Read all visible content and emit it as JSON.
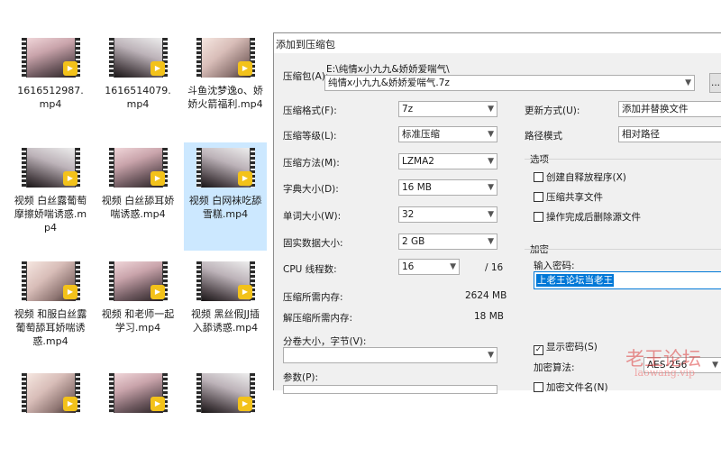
{
  "explorer": {
    "files": [
      {
        "name": "1616512987.mp4",
        "selected": false,
        "variant": ""
      },
      {
        "name": "1616514079.mp4",
        "selected": false,
        "variant": "alt1"
      },
      {
        "name": "斗鱼沈梦逸o、娇娇火箭福利.mp4",
        "selected": false,
        "variant": "alt2"
      },
      {
        "name": "视频 白丝露葡萄摩擦娇喘诱惑.mp4",
        "selected": false,
        "variant": "alt1"
      },
      {
        "name": "视频 白丝舔耳娇喘诱惑.mp4",
        "selected": false,
        "variant": ""
      },
      {
        "name": "视频 白网袜吃舔雪糕.mp4",
        "selected": true,
        "variant": "alt1"
      },
      {
        "name": "视频 和服白丝露葡萄舔耳娇喘诱惑.mp4",
        "selected": false,
        "variant": "alt2"
      },
      {
        "name": "视频 和老师一起学习.mp4",
        "selected": false,
        "variant": ""
      },
      {
        "name": "视频 黑丝假JJ插入舔诱惑.mp4",
        "selected": false,
        "variant": "alt1"
      },
      {
        "name": "",
        "selected": false,
        "variant": "alt2"
      },
      {
        "name": "",
        "selected": false,
        "variant": ""
      },
      {
        "name": "",
        "selected": false,
        "variant": "alt1"
      }
    ],
    "badge_text": "Player"
  },
  "dialog": {
    "title": "添加到压缩包",
    "archive_label": "压缩包(A):",
    "archive_path": "E:\\纯情x小九九&娇娇爱喘气\\",
    "archive_name": "纯情x小九九&娇娇爱喘气.7z",
    "browse_label": "...",
    "format_label": "压缩格式(F):",
    "format_value": "7z",
    "level_label": "压缩等级(L):",
    "level_value": "标准压缩",
    "method_label": "压缩方法(M):",
    "method_value": "LZMA2",
    "dict_label": "字典大小(D):",
    "dict_value": "16 MB",
    "word_label": "单词大小(W):",
    "word_value": "32",
    "solid_label": "固实数据大小:",
    "solid_value": "2 GB",
    "threads_label": "CPU 线程数:",
    "threads_value": "16",
    "threads_total": "/ 16",
    "mem_compress_label": "压缩所需内存:",
    "mem_compress_value": "2624 MB",
    "mem_decompress_label": "解压缩所需内存:",
    "mem_decompress_value": "18 MB",
    "volume_label": "分卷大小，字节(V):",
    "volume_value": "",
    "params_label": "参数(P):",
    "update_label": "更新方式(U):",
    "update_value": "添加并替换文件",
    "pathmode_label": "路径模式",
    "pathmode_value": "相对路径",
    "options_title": "选项",
    "opt_sfx": "创建自释放程序(X)",
    "opt_shared": "压缩共享文件",
    "opt_delete": "操作完成后删除源文件",
    "encrypt_title": "加密",
    "password_label": "输入密码:",
    "password_value": "上老王论坛当老王",
    "show_password": "显示密码(S)",
    "show_password_checked": true,
    "enc_method_label": "加密算法:",
    "enc_method_value": "AES-256",
    "encrypt_names": "加密文件名(N)",
    "encrypt_names_checked": false
  },
  "watermark": {
    "text": "老王论坛",
    "url": "laowang.vip"
  }
}
